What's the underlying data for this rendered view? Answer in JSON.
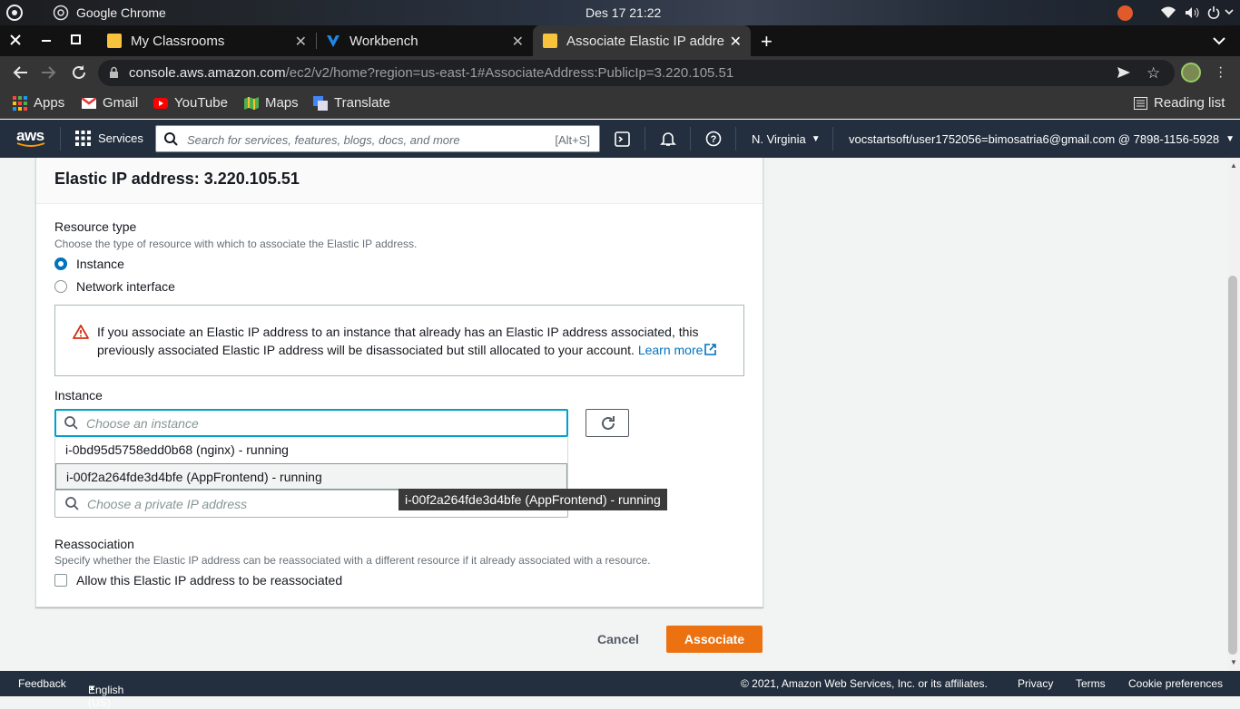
{
  "os": {
    "app_name": "Google Chrome",
    "datetime": "Des 17  21:22"
  },
  "browser": {
    "tabs": [
      {
        "title": "My Classrooms",
        "icon": "classroom-icon"
      },
      {
        "title": "Workbench",
        "icon": "vocareum-icon"
      },
      {
        "title": "Associate Elastic IP addre",
        "icon": "aws-icon",
        "active": true
      }
    ],
    "url_host": "console.aws.amazon.com",
    "url_path": "/ec2/v2/home?region=us-east-1#AssociateAddress:PublicIp=3.220.105.51",
    "bookmarks": [
      "Apps",
      "Gmail",
      "YouTube",
      "Maps",
      "Translate"
    ],
    "reading_list": "Reading list"
  },
  "aws": {
    "services": "Services",
    "search_placeholder": "Search for services, features, blogs, docs, and more",
    "search_shortcut": "[Alt+S]",
    "region": "N. Virginia",
    "account": "vocstartsoft/user1752056=bimosatria6@gmail.com @ 7898-1156-5928"
  },
  "form": {
    "title": "Elastic IP address: 3.220.105.51",
    "resource_type_label": "Resource type",
    "resource_type_desc": "Choose the type of resource with which to associate the Elastic IP address.",
    "options": [
      "Instance",
      "Network interface"
    ],
    "selected_option": "Instance",
    "warning_text": "If you associate an Elastic IP address to an instance that already has an Elastic IP address associated, this previously associated Elastic IP address will be disassociated but still allocated to your account.",
    "warning_link": "Learn more",
    "instance_label": "Instance",
    "instance_placeholder": "Choose an instance",
    "instances": [
      "i-0bd95d5758edd0b68 (nginx) - running",
      "i-00f2a264fde3d4bfe (AppFrontend) - running"
    ],
    "private_ip_placeholder": "Choose a private IP address",
    "tooltip": "i-00f2a264fde3d4bfe (AppFrontend) - running",
    "reassoc_label": "Reassociation",
    "reassoc_desc": "Specify whether the Elastic IP address can be reassociated with a different resource if it already associated with a resource.",
    "reassoc_checkbox": "Allow this Elastic IP address to be reassociated",
    "cancel": "Cancel",
    "associate": "Associate"
  },
  "footer": {
    "feedback": "Feedback",
    "language": "English (US)",
    "copyright": "© 2021, Amazon Web Services, Inc. or its affiliates.",
    "links": [
      "Privacy",
      "Terms",
      "Cookie preferences"
    ]
  },
  "colors": {
    "aws_nav": "#232f3e",
    "primary": "#ec7211",
    "link": "#0073bb",
    "focus": "#00a1c9"
  }
}
